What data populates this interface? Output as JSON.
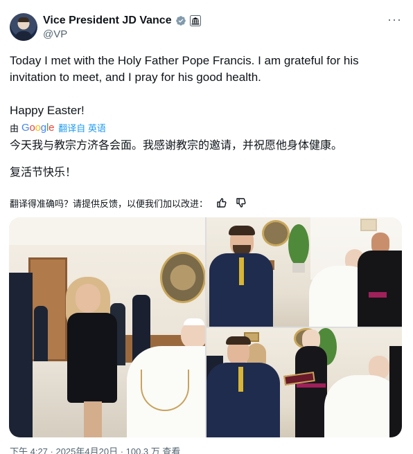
{
  "author": {
    "display_name": "Vice President JD Vance",
    "handle": "@VP",
    "avatar_icon": "avatar-photo",
    "verified_icon": "verified-badge-icon",
    "affiliation_icon": "government-building-icon"
  },
  "more_label": "···",
  "post": {
    "line1": "Today I met with the Holy Father Pope Francis. I am grateful for his invitation to meet, and I pray for his good health.",
    "line2": "Happy Easter!"
  },
  "translation": {
    "by_prefix": "由",
    "provider": "Google",
    "translated_from": "翻译自 英语",
    "text1": "今天我与教宗方济各会面。我感谢教宗的邀请，并祝愿他身体健康。",
    "text2": "复活节快乐！",
    "feedback_prompt": "翻译得准确吗？请提供反馈，以便我们加以改进：",
    "feedback_up_icon": "thumbs-up-icon",
    "feedback_down_icon": "thumbs-down-icon"
  },
  "media": {
    "photo_count": 3
  },
  "footer": {
    "partial_text": "下午 4:27 · 2025年4月20日 · 100.3 万 查看"
  },
  "colors": {
    "text": "#0f1419",
    "muted": "#536471",
    "link": "#1d9bf0",
    "verified_blue": "#1d9bf0",
    "google_blue": "#4285f4",
    "google_red": "#ea4335",
    "google_yellow": "#fbbc05",
    "google_green": "#34a853"
  }
}
